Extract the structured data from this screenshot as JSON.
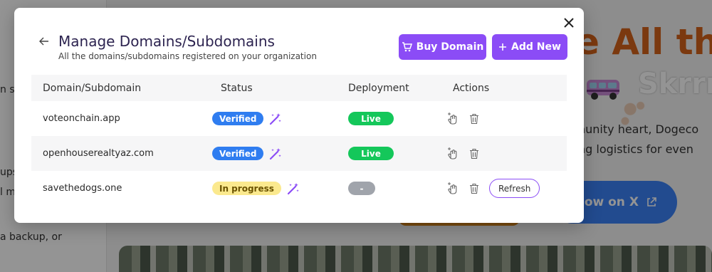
{
  "background": {
    "left_text": [
      "n s",
      "ups",
      "l m",
      "a backup, or"
    ],
    "hero_title": "e All th",
    "hero_subtitle": "Skrrr",
    "body_line_1": "nunity heart, Dogeco",
    "body_line_2": "ng logistics for even",
    "follow_button": "low on X"
  },
  "modal": {
    "title": "Manage Domains/Subdomains",
    "subtitle": "All the domains/subdomains registered on your organization",
    "buy_domain_label": "Buy Domain",
    "add_new_label": "Add New",
    "table": {
      "headers": {
        "domain": "Domain/Subdomain",
        "status": "Status",
        "deployment": "Deployment",
        "actions": "Actions"
      },
      "rows": [
        {
          "domain": "voteonchain.app",
          "status": "Verified",
          "deployment": "Live"
        },
        {
          "domain": "openhouserealtyaz.com",
          "status": "Verified",
          "deployment": "Live"
        },
        {
          "domain": "savethedogs.one",
          "status": "In progress",
          "deployment": "-",
          "action_label": "Refresh"
        }
      ]
    }
  },
  "colors": {
    "accent": "#8b4cf6",
    "verified": "#2f7df0",
    "live": "#14c75a",
    "in_progress": "#fbe98e",
    "title": "#2d2450"
  },
  "icons": {
    "close": "close-icon",
    "back": "back-arrow-icon",
    "cart": "cart-icon",
    "plus": "plus-icon",
    "magic": "magic-wand-icon",
    "deploy": "deploy-hand-icon",
    "delete": "trash-icon"
  }
}
